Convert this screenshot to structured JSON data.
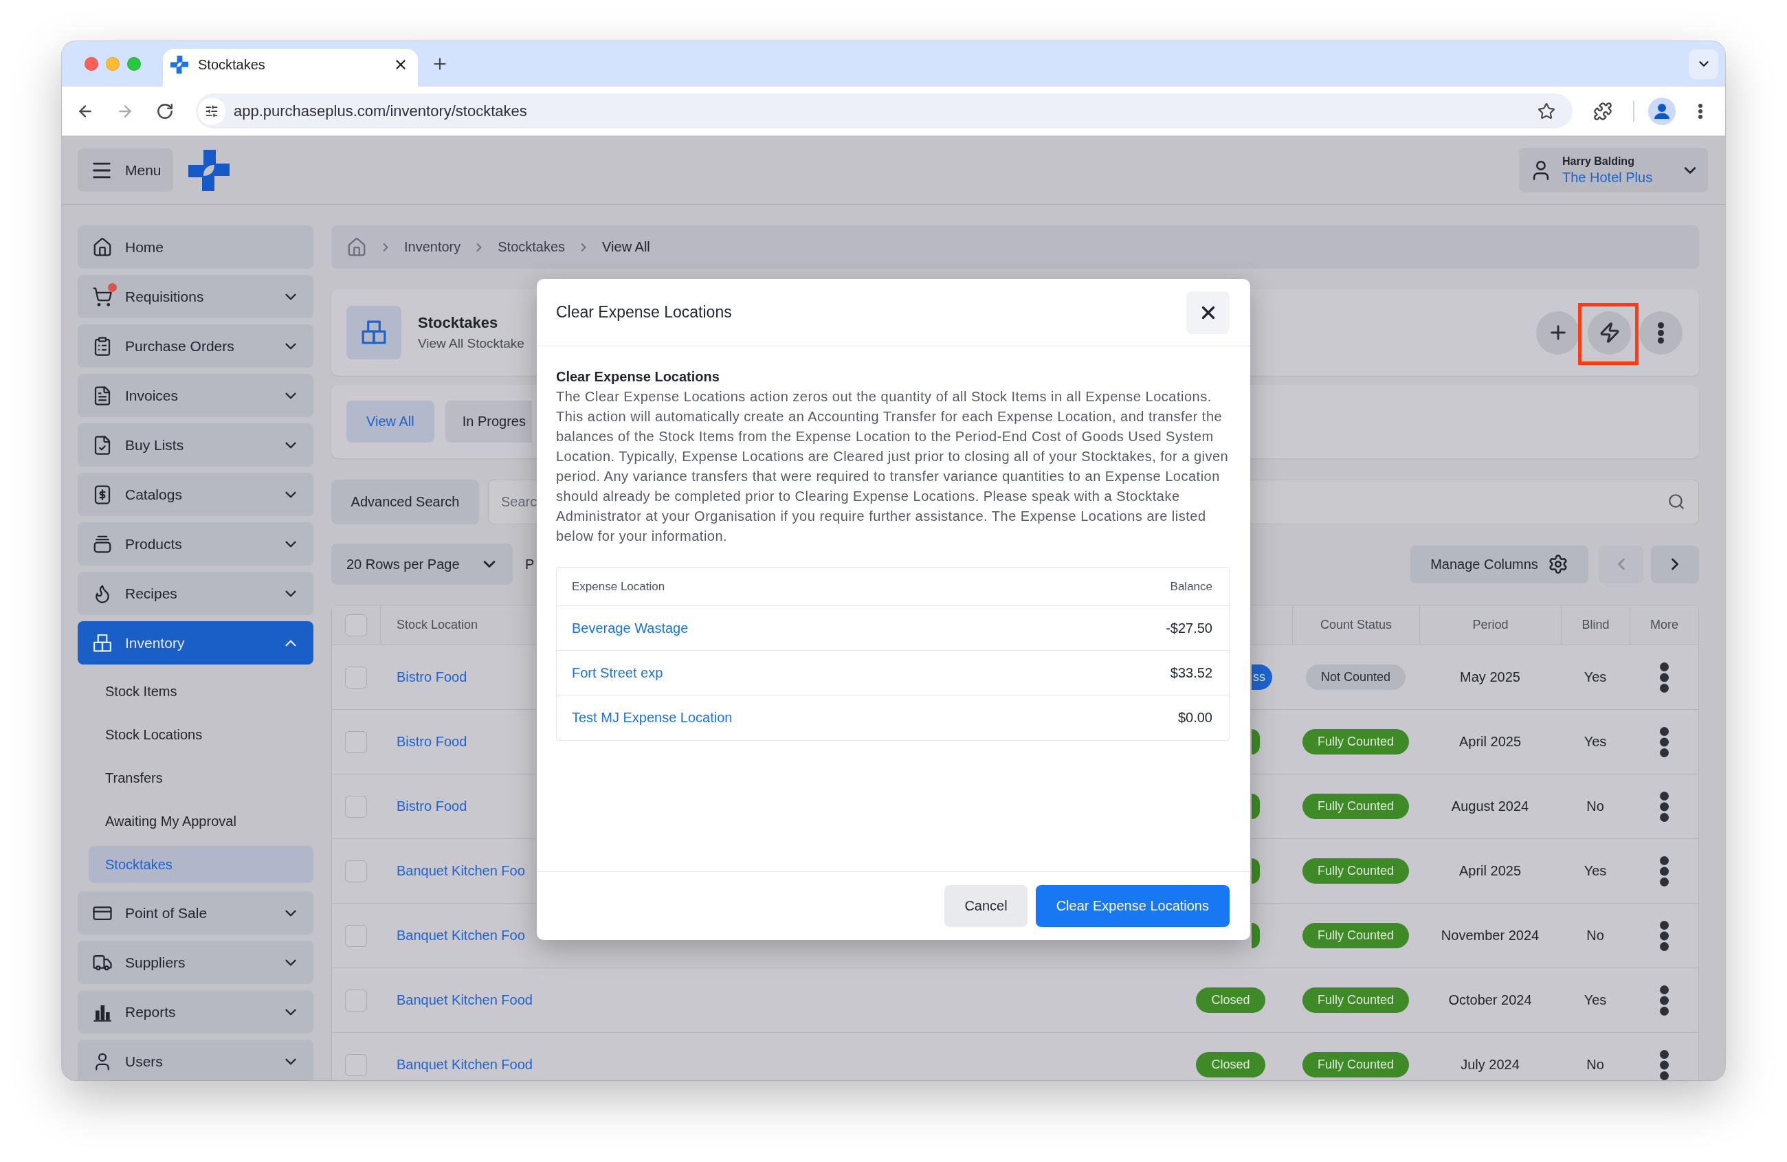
{
  "browser": {
    "tab_title": "Stocktakes",
    "url": "app.purchaseplus.com/inventory/stocktakes"
  },
  "header": {
    "menu_label": "Menu",
    "user_name": "Harry Balding",
    "organisation": "The Hotel Plus"
  },
  "sidebar": [
    {
      "kind": "link",
      "label": "Home",
      "selected": false,
      "alert": false
    },
    {
      "kind": "group",
      "label": "Requisitions",
      "selected": false,
      "expanded": false,
      "alert": true
    },
    {
      "kind": "group",
      "label": "Purchase Orders",
      "selected": false,
      "expanded": false,
      "alert": false
    },
    {
      "kind": "group",
      "label": "Invoices",
      "selected": false,
      "expanded": false,
      "alert": false
    },
    {
      "kind": "group",
      "label": "Buy Lists",
      "selected": false,
      "expanded": false,
      "alert": false
    },
    {
      "kind": "group",
      "label": "Catalogs",
      "selected": false,
      "expanded": false,
      "alert": false
    },
    {
      "kind": "group",
      "label": "Products",
      "selected": false,
      "expanded": false,
      "alert": false
    },
    {
      "kind": "group",
      "label": "Recipes",
      "selected": false,
      "expanded": false,
      "alert": false
    },
    {
      "kind": "group",
      "label": "Inventory",
      "selected": true,
      "expanded": true,
      "alert": false,
      "children": [
        {
          "label": "Stock Items",
          "selected": false
        },
        {
          "label": "Stock Locations",
          "selected": false
        },
        {
          "label": "Transfers",
          "selected": false
        },
        {
          "label": "Awaiting My Approval",
          "selected": false
        },
        {
          "label": "Stocktakes",
          "selected": true
        }
      ]
    },
    {
      "kind": "group",
      "label": "Point of Sale",
      "selected": false,
      "expanded": false,
      "alert": false
    },
    {
      "kind": "group",
      "label": "Suppliers",
      "selected": false,
      "expanded": false,
      "alert": false
    },
    {
      "kind": "group",
      "label": "Reports",
      "selected": false,
      "expanded": false,
      "alert": false
    },
    {
      "kind": "group",
      "label": "Users",
      "selected": false,
      "expanded": false,
      "alert": false
    }
  ],
  "breadcrumb": [
    "Inventory",
    "Stocktakes",
    "View All"
  ],
  "page_header": {
    "title": "Stocktakes",
    "subtitle": "View All Stocktake",
    "actions": [
      {
        "highlighted": false
      },
      {
        "highlighted": true
      },
      {
        "highlighted": false
      }
    ]
  },
  "filter_tabs": [
    {
      "label": "View All",
      "selected": true
    },
    {
      "label": "In Progres",
      "selected": false
    }
  ],
  "search": {
    "button": "Advanced Search",
    "placeholder": "Searc"
  },
  "list_controls": {
    "rows_per_page": "20 Rows per Page",
    "page_label": "P",
    "manage_columns": "Manage Columns",
    "previous_disabled": true,
    "next_disabled": false
  },
  "table": {
    "select_all_checked": false,
    "columns": [
      "Stock Location",
      "Count Status",
      "Period",
      "Blind",
      "More"
    ],
    "rows": [
      {
        "checked": false,
        "stock_location": "Bistro Food",
        "status": {
          "text": "ss",
          "color": "#1d63d1"
        },
        "count_status": {
          "text": "Not Counted",
          "color": "#b5b7bf"
        },
        "period": "May 2025",
        "blind": "Yes"
      },
      {
        "checked": false,
        "stock_location": "Bistro Food",
        "status": {
          "color": "#3e8a26"
        },
        "count_status": {
          "text": "Fully Counted",
          "color": "#3e8a26"
        },
        "period": "April 2025",
        "blind": "Yes"
      },
      {
        "checked": false,
        "stock_location": "Bistro Food",
        "status": {
          "color": "#3e8a26"
        },
        "count_status": {
          "text": "Fully Counted",
          "color": "#3e8a26"
        },
        "period": "August 2024",
        "blind": "No"
      },
      {
        "checked": false,
        "stock_location": "Banquet Kitchen Foo",
        "status": {
          "color": "#3e8a26"
        },
        "count_status": {
          "text": "Fully Counted",
          "color": "#3e8a26"
        },
        "period": "April 2025",
        "blind": "Yes"
      },
      {
        "checked": false,
        "stock_location": "Banquet Kitchen Foo",
        "status": {
          "color": "#3e8a26"
        },
        "count_status": {
          "text": "Fully Counted",
          "color": "#3e8a26"
        },
        "period": "November 2024",
        "blind": "No"
      },
      {
        "checked": false,
        "stock_location": "Banquet Kitchen Food",
        "status": {
          "text": "Closed",
          "color": "#3e8a26"
        },
        "count_status": {
          "text": "Fully Counted",
          "color": "#3e8a26"
        },
        "period": "October 2024",
        "blind": "Yes"
      },
      {
        "checked": false,
        "stock_location": "Banquet Kitchen Food",
        "status": {
          "text": "Closed",
          "color": "#3e8a26"
        },
        "count_status": {
          "text": "Fully Counted",
          "color": "#3e8a26"
        },
        "period": "July 2024",
        "blind": "No"
      }
    ]
  },
  "dialog": {
    "title": "Clear Expense Locations",
    "heading": "Clear Expense Locations",
    "description": "The Clear Expense Locations action zeros out the quantity of all Stock Items in all Expense Locations. This action will automatically create an Accounting Transfer for each Expense Location, and transfer the balances of the Stock Items from the Expense Location to the Period-End Cost of Goods Used System Location. Typically, Expense Locations are Cleared just prior to closing all of your Stocktakes, for a given period. Any variance transfers that were required to transfer variance quantities to an Expense Location should already be completed prior to Clearing Expense Locations. Please speak with a Stocktake Administrator at your Organisation if you require further assistance. The Expense Locations are listed below for your information.",
    "table": {
      "columns": [
        "Expense Location",
        "Balance"
      ],
      "rows": [
        {
          "location": "Beverage Wastage",
          "balance": "-$27.50"
        },
        {
          "location": "Fort Street exp",
          "balance": "$33.52"
        },
        {
          "location": "Test MJ Expense Location",
          "balance": "$0.00"
        }
      ]
    },
    "buttons": [
      {
        "kind": "secondary",
        "label": "Cancel"
      },
      {
        "kind": "primary",
        "label": "Clear Expense Locations"
      }
    ]
  }
}
